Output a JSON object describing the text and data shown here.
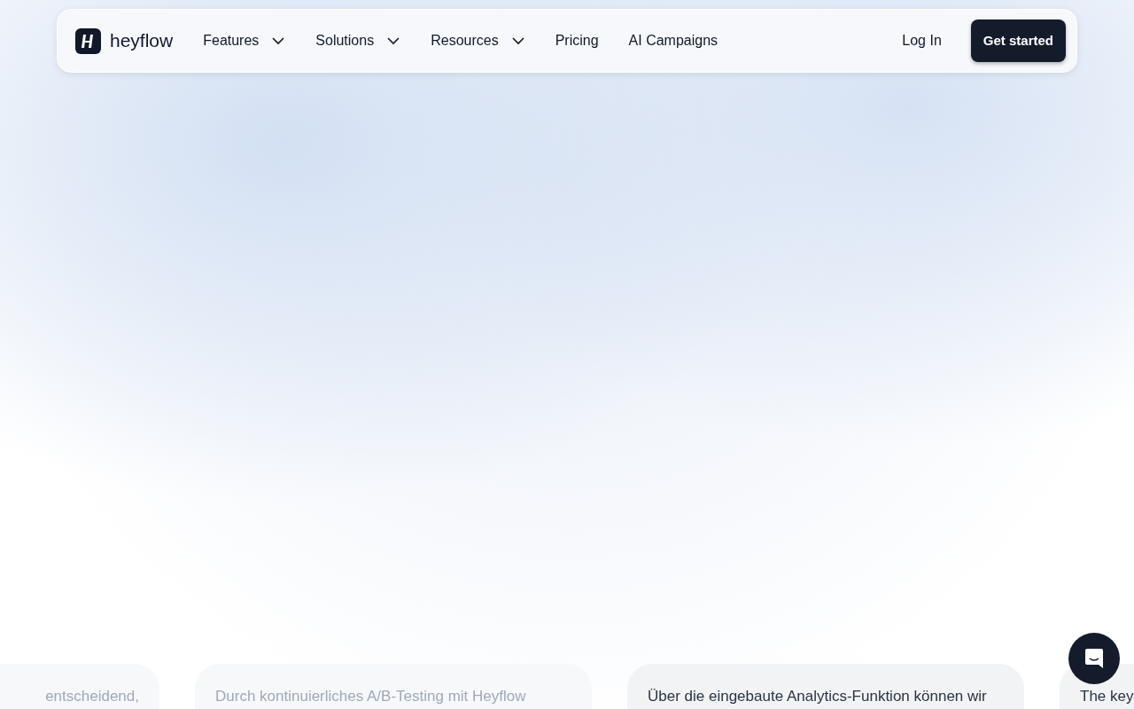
{
  "nav": {
    "brand": "heyflow",
    "items": [
      {
        "label": "Features",
        "dropdown": true
      },
      {
        "label": "Solutions",
        "dropdown": true
      },
      {
        "label": "Resources",
        "dropdown": true
      },
      {
        "label": "Pricing",
        "dropdown": false
      },
      {
        "label": "AI Campaigns",
        "dropdown": false
      }
    ],
    "login": "Log In",
    "cta": "Get started"
  },
  "cards": [
    {
      "text": "entscheidend,",
      "faded": true
    },
    {
      "text": "Durch kontinuierliches A/B-Testing mit Heyflow",
      "faded": true
    },
    {
      "text": "Über die eingebaute Analytics-Funktion können wir",
      "faded": false
    },
    {
      "text": "The key",
      "faded": false
    }
  ]
}
